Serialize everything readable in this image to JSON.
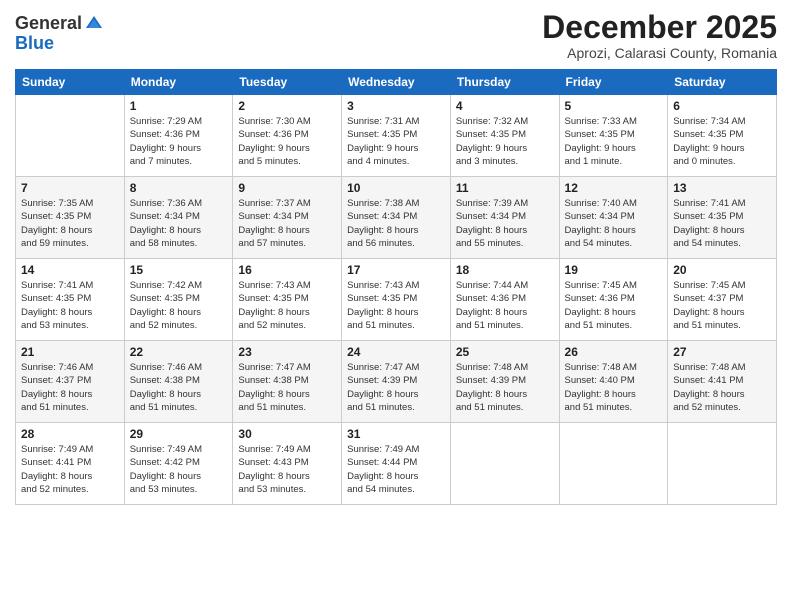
{
  "logo": {
    "general": "General",
    "blue": "Blue"
  },
  "header": {
    "month": "December 2025",
    "location": "Aprozi, Calarasi County, Romania"
  },
  "days_of_week": [
    "Sunday",
    "Monday",
    "Tuesday",
    "Wednesday",
    "Thursday",
    "Friday",
    "Saturday"
  ],
  "weeks": [
    [
      {
        "day": "",
        "info": ""
      },
      {
        "day": "1",
        "info": "Sunrise: 7:29 AM\nSunset: 4:36 PM\nDaylight: 9 hours\nand 7 minutes."
      },
      {
        "day": "2",
        "info": "Sunrise: 7:30 AM\nSunset: 4:36 PM\nDaylight: 9 hours\nand 5 minutes."
      },
      {
        "day": "3",
        "info": "Sunrise: 7:31 AM\nSunset: 4:35 PM\nDaylight: 9 hours\nand 4 minutes."
      },
      {
        "day": "4",
        "info": "Sunrise: 7:32 AM\nSunset: 4:35 PM\nDaylight: 9 hours\nand 3 minutes."
      },
      {
        "day": "5",
        "info": "Sunrise: 7:33 AM\nSunset: 4:35 PM\nDaylight: 9 hours\nand 1 minute."
      },
      {
        "day": "6",
        "info": "Sunrise: 7:34 AM\nSunset: 4:35 PM\nDaylight: 9 hours\nand 0 minutes."
      }
    ],
    [
      {
        "day": "7",
        "info": "Sunrise: 7:35 AM\nSunset: 4:35 PM\nDaylight: 8 hours\nand 59 minutes."
      },
      {
        "day": "8",
        "info": "Sunrise: 7:36 AM\nSunset: 4:34 PM\nDaylight: 8 hours\nand 58 minutes."
      },
      {
        "day": "9",
        "info": "Sunrise: 7:37 AM\nSunset: 4:34 PM\nDaylight: 8 hours\nand 57 minutes."
      },
      {
        "day": "10",
        "info": "Sunrise: 7:38 AM\nSunset: 4:34 PM\nDaylight: 8 hours\nand 56 minutes."
      },
      {
        "day": "11",
        "info": "Sunrise: 7:39 AM\nSunset: 4:34 PM\nDaylight: 8 hours\nand 55 minutes."
      },
      {
        "day": "12",
        "info": "Sunrise: 7:40 AM\nSunset: 4:34 PM\nDaylight: 8 hours\nand 54 minutes."
      },
      {
        "day": "13",
        "info": "Sunrise: 7:41 AM\nSunset: 4:35 PM\nDaylight: 8 hours\nand 54 minutes."
      }
    ],
    [
      {
        "day": "14",
        "info": "Sunrise: 7:41 AM\nSunset: 4:35 PM\nDaylight: 8 hours\nand 53 minutes."
      },
      {
        "day": "15",
        "info": "Sunrise: 7:42 AM\nSunset: 4:35 PM\nDaylight: 8 hours\nand 52 minutes."
      },
      {
        "day": "16",
        "info": "Sunrise: 7:43 AM\nSunset: 4:35 PM\nDaylight: 8 hours\nand 52 minutes."
      },
      {
        "day": "17",
        "info": "Sunrise: 7:43 AM\nSunset: 4:35 PM\nDaylight: 8 hours\nand 51 minutes."
      },
      {
        "day": "18",
        "info": "Sunrise: 7:44 AM\nSunset: 4:36 PM\nDaylight: 8 hours\nand 51 minutes."
      },
      {
        "day": "19",
        "info": "Sunrise: 7:45 AM\nSunset: 4:36 PM\nDaylight: 8 hours\nand 51 minutes."
      },
      {
        "day": "20",
        "info": "Sunrise: 7:45 AM\nSunset: 4:37 PM\nDaylight: 8 hours\nand 51 minutes."
      }
    ],
    [
      {
        "day": "21",
        "info": "Sunrise: 7:46 AM\nSunset: 4:37 PM\nDaylight: 8 hours\nand 51 minutes."
      },
      {
        "day": "22",
        "info": "Sunrise: 7:46 AM\nSunset: 4:38 PM\nDaylight: 8 hours\nand 51 minutes."
      },
      {
        "day": "23",
        "info": "Sunrise: 7:47 AM\nSunset: 4:38 PM\nDaylight: 8 hours\nand 51 minutes."
      },
      {
        "day": "24",
        "info": "Sunrise: 7:47 AM\nSunset: 4:39 PM\nDaylight: 8 hours\nand 51 minutes."
      },
      {
        "day": "25",
        "info": "Sunrise: 7:48 AM\nSunset: 4:39 PM\nDaylight: 8 hours\nand 51 minutes."
      },
      {
        "day": "26",
        "info": "Sunrise: 7:48 AM\nSunset: 4:40 PM\nDaylight: 8 hours\nand 51 minutes."
      },
      {
        "day": "27",
        "info": "Sunrise: 7:48 AM\nSunset: 4:41 PM\nDaylight: 8 hours\nand 52 minutes."
      }
    ],
    [
      {
        "day": "28",
        "info": "Sunrise: 7:49 AM\nSunset: 4:41 PM\nDaylight: 8 hours\nand 52 minutes."
      },
      {
        "day": "29",
        "info": "Sunrise: 7:49 AM\nSunset: 4:42 PM\nDaylight: 8 hours\nand 53 minutes."
      },
      {
        "day": "30",
        "info": "Sunrise: 7:49 AM\nSunset: 4:43 PM\nDaylight: 8 hours\nand 53 minutes."
      },
      {
        "day": "31",
        "info": "Sunrise: 7:49 AM\nSunset: 4:44 PM\nDaylight: 8 hours\nand 54 minutes."
      },
      {
        "day": "",
        "info": ""
      },
      {
        "day": "",
        "info": ""
      },
      {
        "day": "",
        "info": ""
      }
    ]
  ]
}
